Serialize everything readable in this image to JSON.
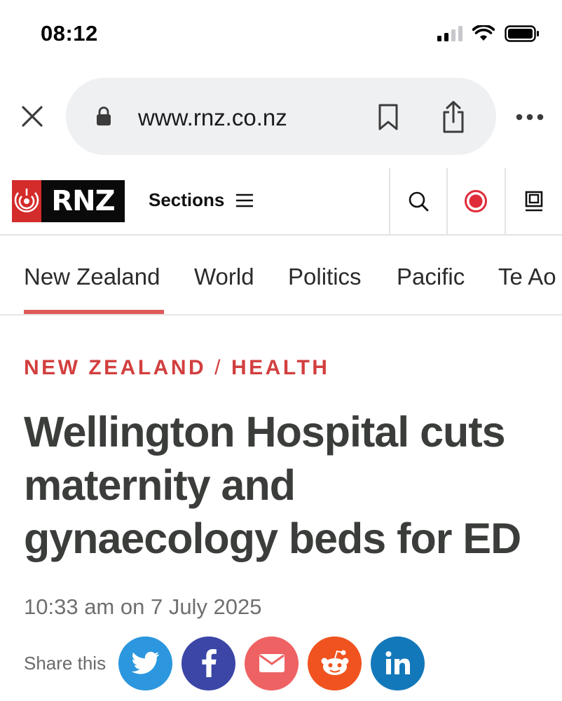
{
  "status_bar": {
    "time": "08:12"
  },
  "browser": {
    "url": "www.rnz.co.nz"
  },
  "header": {
    "logo_text": "RNZ",
    "sections_label": "Sections"
  },
  "tabs": [
    {
      "label": "New Zealand",
      "active": true
    },
    {
      "label": "World"
    },
    {
      "label": "Politics"
    },
    {
      "label": "Pacific"
    },
    {
      "label": "Te Ao"
    }
  ],
  "article": {
    "kicker_primary": "NEW ZEALAND",
    "kicker_separator": "/",
    "kicker_secondary": "HEALTH",
    "headline": "Wellington Hospital cuts maternity and gynaecology beds for ED",
    "timestamp": "10:33 am on 7 July 2025"
  },
  "share": {
    "label": "Share this",
    "buttons": [
      {
        "name": "twitter",
        "color": "#2c97de"
      },
      {
        "name": "facebook",
        "color": "#3b46a6"
      },
      {
        "name": "email",
        "color": "#ee6263"
      },
      {
        "name": "reddit",
        "color": "#f0531f"
      },
      {
        "name": "linkedin",
        "color": "#1378ba"
      }
    ]
  },
  "colors": {
    "accent": "#d23f3f",
    "headline": "#3a3d3a",
    "pill": "#eff0f2"
  }
}
